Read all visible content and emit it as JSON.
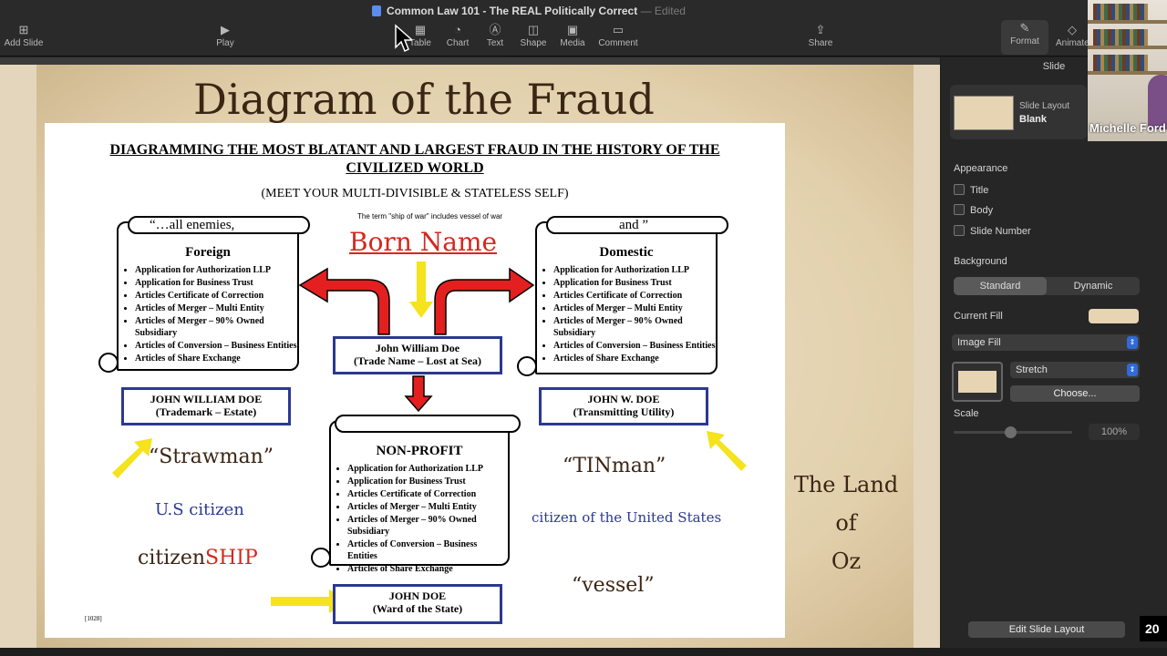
{
  "window": {
    "title": "Common Law 101 - The REAL Politically Correct",
    "separator": "—",
    "status": "Edited"
  },
  "toolbar": {
    "add_slide": "Add Slide",
    "play": "Play",
    "table": "Table",
    "chart": "Chart",
    "text": "Text",
    "shape": "Shape",
    "media": "Media",
    "comment": "Comment",
    "share": "Share",
    "format": "Format",
    "animate": "Animate"
  },
  "slide": {
    "title": "Diagram of the Fraud",
    "doc_heading": "DIAGRAMMING THE MOST BLATANT AND LARGEST FRAUD IN THE HISTORY OF THE CIVILIZED WORLD",
    "doc_subheading": "(MEET YOUR MULTI-DIVISIBLE & STATELESS SELF)",
    "note": "The term \"ship of war\" includes vessel of war",
    "born_name": "Born Name",
    "left_scroll": {
      "banner": "“…all enemies,",
      "heading": "Foreign",
      "items": [
        "Application for Authorization LLP",
        "Application for Business Trust",
        "Articles Certificate of Correction",
        "Articles of Merger – Multi Entity",
        "Articles of Merger – 90% Owned Subsidiary",
        "Articles of Conversion – Business Entities",
        "Articles of Share Exchange"
      ]
    },
    "right_scroll": {
      "banner": "and ”",
      "heading": "Domestic",
      "items": [
        "Application for Authorization LLP",
        "Application for Business Trust",
        "Articles Certificate of Correction",
        "Articles of Merger – Multi Entity",
        "Articles of Merger – 90% Owned Subsidiary",
        "Articles of Conversion – Business Entities",
        "Articles of Share Exchange"
      ]
    },
    "center_scroll": {
      "heading": "NON-PROFIT",
      "items": [
        "Application for Authorization LLP",
        "Application for Business Trust",
        "Articles Certificate of Correction",
        "Articles of Merger – Multi Entity",
        "Articles of Merger – 90% Owned Subsidiary",
        "Articles of Conversion – Business Entities",
        "Articles of Share Exchange"
      ]
    },
    "box_trade": {
      "line1": "John William Doe",
      "line2": "(Trade Name – Lost at Sea)"
    },
    "box_trademark": {
      "line1": "JOHN WILLIAM DOE",
      "line2": "(Trademark – Estate)"
    },
    "box_utility": {
      "line1": "JOHN W. DOE",
      "line2": "(Transmitting Utility)"
    },
    "box_ward": {
      "line1": "JOHN DOE",
      "line2": "(Ward of the State)"
    },
    "strawman": "“Strawman”",
    "us_citizen": "U.S citizen",
    "citizenship_a": "citizen",
    "citizenship_b": "SHIP",
    "tinman": "“TINman”",
    "citizen_of_us": "citizen of the United States",
    "vessel": "“vessel”",
    "code": "[1028]",
    "oz_line1": "The Land",
    "oz_line2": "of",
    "oz_line3": "Oz"
  },
  "inspector": {
    "panel_title": "Slide",
    "layout_label": "Slide Layout",
    "layout_value": "Blank",
    "appearance": "Appearance",
    "title_chk": "Title",
    "body_chk": "Body",
    "slide_number_chk": "Slide Number",
    "background": "Background",
    "standard": "Standard",
    "dynamic": "Dynamic",
    "current_fill": "Current Fill",
    "fill_type": "Image Fill",
    "stretch": "Stretch",
    "choose": "Choose...",
    "scale": "Scale",
    "scale_value": "100%",
    "edit_layout": "Edit Slide Layout"
  },
  "webcam": {
    "name": "Michelle Ford"
  },
  "clock": "20",
  "colors": {
    "accent_red": "#d3281f",
    "box_blue": "#2b3990",
    "arrow_yellow": "#f4e31d"
  }
}
